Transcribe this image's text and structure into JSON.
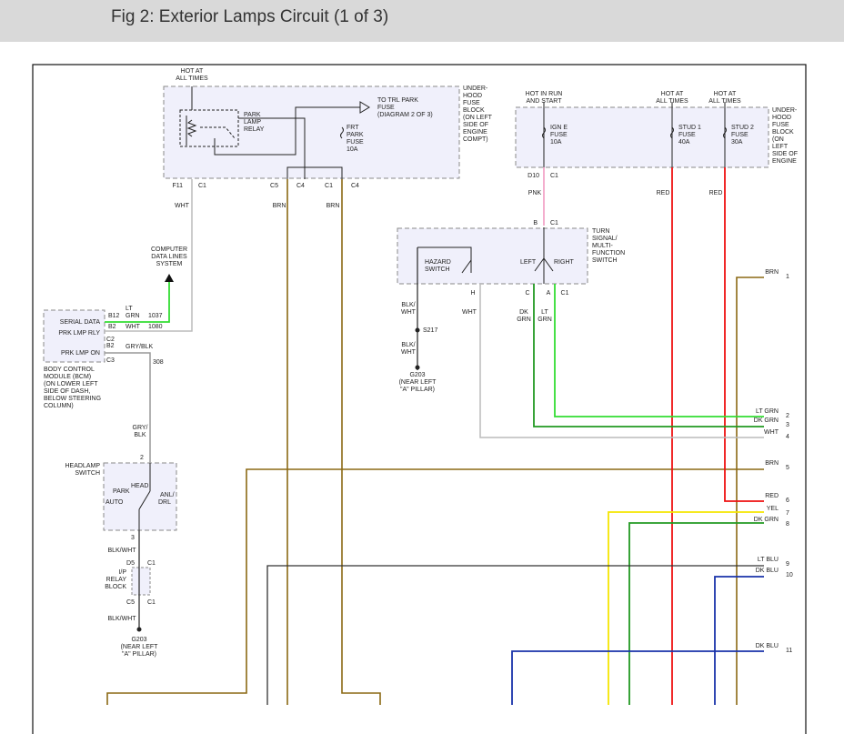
{
  "header": {
    "title": "Fig 2: Exterior Lamps Circuit (1 of 3)"
  },
  "colors": {
    "header_bg": "#d9d9d9",
    "box_fill": "#f0f0fb",
    "box_border": "#8a8a8a",
    "wire_brn": "#8b6914",
    "wire_ltgrn": "#33dd33",
    "wire_dkgrn": "#229922",
    "wire_wht": "#bbbbbb",
    "wire_red": "#ee1111",
    "wire_yel": "#f5e600",
    "wire_ltblu": "#333333",
    "wire_dkblu": "#1a33aa",
    "wire_pnk": "#f3a6c8",
    "wire_blk": "#222222",
    "wire_gry": "#999999"
  },
  "labels": {
    "hot_at_all_times_l1": "HOT AT",
    "hot_at_all_times_l2": "ALL TIMES",
    "park_lamp_relay": [
      "PARK",
      "LAMP",
      "RELAY"
    ],
    "to_trl_park_fuse": [
      "TO TRL PARK",
      "FUSE",
      "(DIAGRAM 2 OF 3)"
    ],
    "frt_park_fuse": [
      "FRT",
      "PARK",
      "FUSE",
      "10A"
    ],
    "underhood_left": [
      "UNDER-",
      "HOOD",
      "FUSE",
      "BLOCK",
      "(ON LEFT",
      "SIDE OF",
      "ENGINE",
      "COMPT)"
    ],
    "underhood_right": [
      "UNDER-",
      "HOOD",
      "FUSE",
      "BLOCK",
      "(ON",
      "LEFT",
      "SIDE OF",
      "ENGINE"
    ],
    "hot_run_start": [
      "HOT IN RUN",
      "AND START"
    ],
    "hot_at_all_times_2": [
      "HOT AT",
      "ALL TIMES"
    ],
    "hot_at_all_times_3": [
      "HOT AT",
      "ALL TIMES"
    ],
    "ign_e_fuse": [
      "IGN E",
      "FUSE",
      "10A"
    ],
    "stud1_fuse": [
      "STUD 1",
      "FUSE",
      "40A"
    ],
    "stud2_fuse": [
      "STUD 2",
      "FUSE",
      "30A"
    ],
    "f11": "F11",
    "c1": "C1",
    "c5": "C5",
    "c4": "C4",
    "d10": "D10",
    "b": "B",
    "a": "A",
    "c": "C",
    "h": "H",
    "wht": "WHT",
    "brn": "BRN",
    "pnk": "PNK",
    "red": "RED",
    "turn_signal_switch": [
      "TURN",
      "SIGNAL/",
      "MULTI-",
      "FUNCTION",
      "SWITCH"
    ],
    "hazard_switch": [
      "HAZARD",
      "SWITCH"
    ],
    "left": "LEFT",
    "right": "RIGHT",
    "blk_wht_2l": [
      "BLK/",
      "WHT"
    ],
    "dk_grn_2l": [
      "DK",
      "GRN"
    ],
    "lt_grn_2l": [
      "LT",
      "GRN"
    ],
    "s217": "S217",
    "g203_note": [
      "G203",
      "(NEAR LEFT",
      "\"A\" PILLAR)"
    ],
    "computer_data_lines": [
      "COMPUTER",
      "DATA LINES",
      "SYSTEM"
    ],
    "serial_data": "SERIAL DATA",
    "prk_lmp_rly": "PRK LMP RLY",
    "prk_lmp_on": "PRK LMP ON",
    "b12": "B12",
    "b2": "B2",
    "c2": "C2",
    "b2b": "B2",
    "c3": "C3",
    "lt_grn_wire": [
      "LT",
      "GRN"
    ],
    "n1037": "1037",
    "n1080": "1080",
    "gry_blk": "GRY/BLK",
    "n308": "308",
    "bcm_note": [
      "BODY CONTROL",
      "MODULE (BCM)",
      "(ON LOWER LEFT",
      "SIDE OF DASH,",
      "BELOW STEERING",
      "COLUMN)"
    ],
    "gry_blk_2l": [
      "GRY/",
      "BLK"
    ],
    "pin2": "2",
    "pin3": "3",
    "headlamp_switch": [
      "HEADLAMP",
      "SWITCH"
    ],
    "head": "HEAD",
    "park": "PARK",
    "auto": "AUTO",
    "anl": "ANL/",
    "drl": "DRL",
    "blk_wht": "BLK/WHT",
    "d5": "D5",
    "c1b": "C1",
    "ip_relay_block": [
      "I/P",
      "RELAY",
      "BLOCK"
    ],
    "c5b": "C5",
    "c1c": "C1"
  },
  "right_wires": [
    {
      "color": "BRN",
      "num": "1"
    },
    {
      "color": "LT GRN",
      "num": "2"
    },
    {
      "color": "DK GRN",
      "num": "3"
    },
    {
      "color": "WHT",
      "num": "4"
    },
    {
      "color": "BRN",
      "num": "5"
    },
    {
      "color": "RED",
      "num": "6"
    },
    {
      "color": "YEL",
      "num": "7"
    },
    {
      "color": "DK GRN",
      "num": "8"
    },
    {
      "color": "LT BLU",
      "num": "9"
    },
    {
      "color": "DK BLU",
      "num": "10"
    },
    {
      "color": "DK BLU",
      "num": "11"
    }
  ]
}
